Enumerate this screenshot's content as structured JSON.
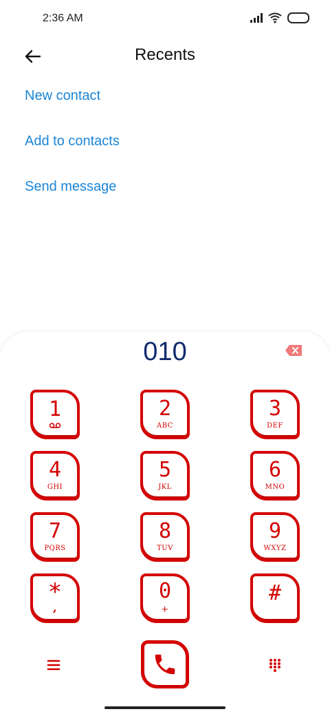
{
  "status_bar": {
    "time": "2:36 AM",
    "signal_icon": "signal-icon",
    "wifi_icon": "wifi-icon",
    "battery_icon": "battery-icon"
  },
  "header": {
    "back_icon": "arrow-left-icon",
    "title": "Recents"
  },
  "options": [
    "New contact",
    "Add to contacts",
    "Send message"
  ],
  "dialer": {
    "number": "010",
    "backspace_icon": "backspace-icon",
    "keys": [
      {
        "digit": "1",
        "letters": "",
        "icon": "voicemail-icon"
      },
      {
        "digit": "2",
        "letters": "ABC"
      },
      {
        "digit": "3",
        "letters": "DEF"
      },
      {
        "digit": "4",
        "letters": "GHI"
      },
      {
        "digit": "5",
        "letters": "JKL"
      },
      {
        "digit": "6",
        "letters": "MNO"
      },
      {
        "digit": "7",
        "letters": "PQRS"
      },
      {
        "digit": "8",
        "letters": "TUV"
      },
      {
        "digit": "9",
        "letters": "WXYZ"
      },
      {
        "digit": "*",
        "letters": ","
      },
      {
        "digit": "0",
        "letters": "+"
      },
      {
        "digit": "#",
        "letters": ""
      }
    ],
    "menu_icon": "menu-icon",
    "call_icon": "phone-icon",
    "grid_icon": "dialpad-icon"
  },
  "colors": {
    "accent_link": "#1a86d8",
    "dial_number": "#0f2a6d",
    "key_red": "#d40000"
  }
}
